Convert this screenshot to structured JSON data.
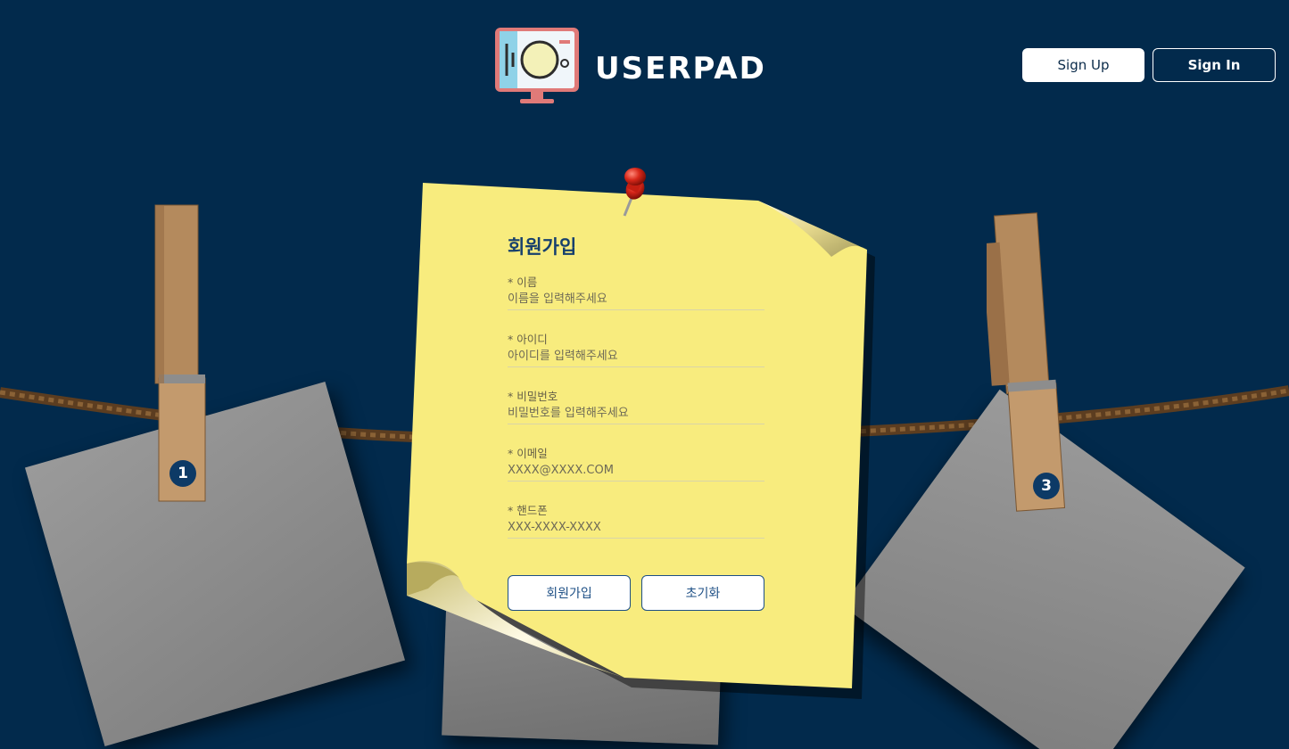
{
  "header": {
    "brand": "USERPAD",
    "signup_label": "Sign Up",
    "signin_label": "Sign In"
  },
  "pegs": [
    {
      "number": "1"
    },
    {
      "number": "3"
    }
  ],
  "form": {
    "title": "회원가입",
    "fields": [
      {
        "label": "* 이름",
        "placeholder": "이름을 입력해주세요"
      },
      {
        "label": "* 아이디",
        "placeholder": "아이디를 입력해주세요"
      },
      {
        "label": "* 비밀번호",
        "placeholder": "비밀번호를 입력해주세요"
      },
      {
        "label": "* 이메일",
        "placeholder": "XXXX@XXXX.COM"
      },
      {
        "label": "* 핸드폰",
        "placeholder": "XXX-XXXX-XXXX"
      }
    ],
    "submit_label": "회원가입",
    "reset_label": "초기화"
  },
  "colors": {
    "background": "#022a4c",
    "note_yellow": "#f8ec7e",
    "title_blue": "#17406d",
    "button_border": "#1d4f85"
  }
}
